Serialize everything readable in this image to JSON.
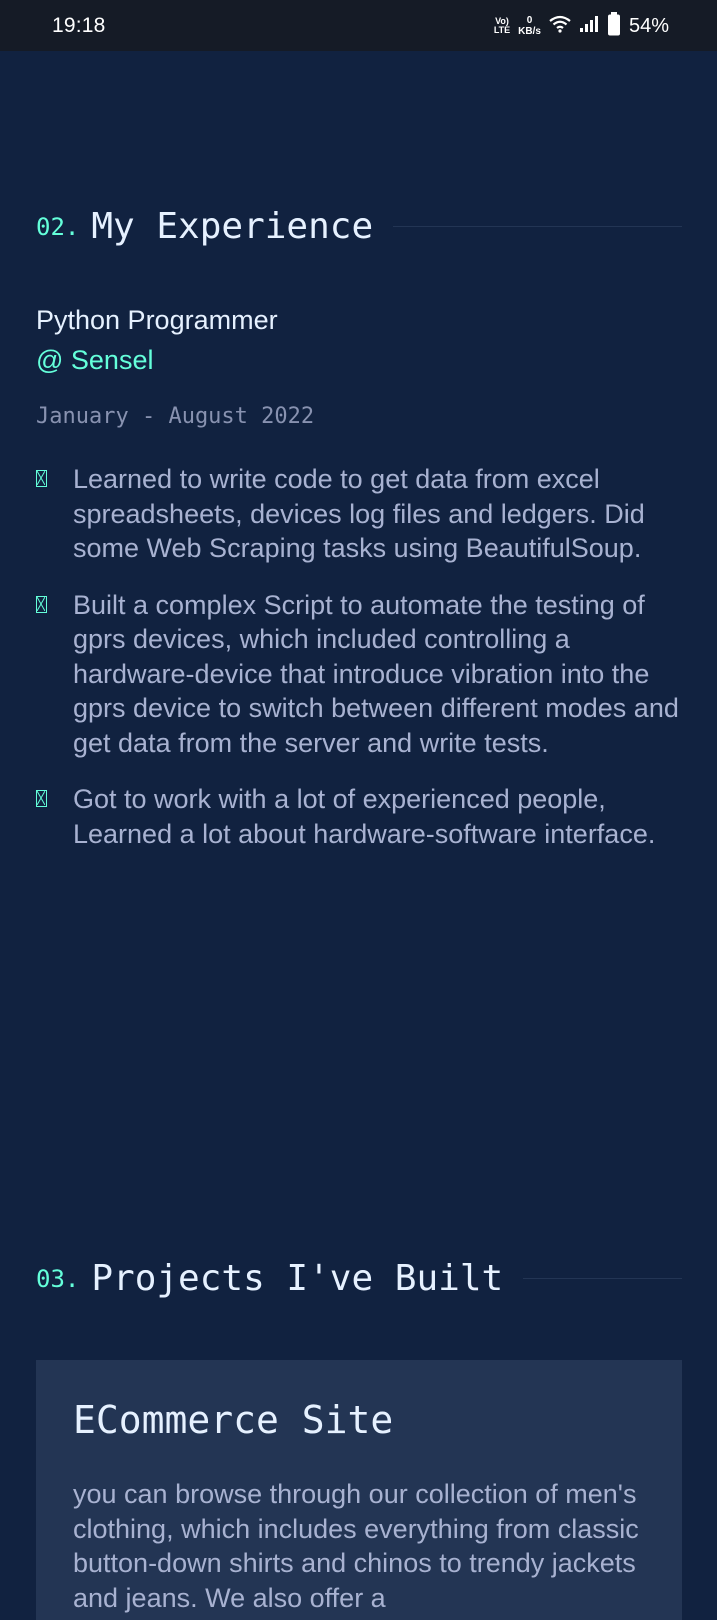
{
  "status_bar": {
    "time": "19:18",
    "volte_top": "Vo)",
    "volte_bottom": "LTE",
    "speed_value": "0",
    "speed_unit": "KB/s",
    "battery": "54%",
    "icons": [
      "wifi-icon",
      "signal-icon",
      "battery-icon"
    ]
  },
  "experience": {
    "number": "02.",
    "title": "My Experience",
    "job_title": "Python Programmer",
    "company": "@ Sensel",
    "dates": "January - August 2022",
    "bullets": [
      "Learned to write code to get data from excel spreadsheets, devices log files and ledgers. Did some Web Scraping tasks using BeautifulSoup.",
      "Built a complex Script to automate the testing of gprs devices, which included controlling a hardware-device that introduce vibration into the gprs device to switch between different modes and get data from the server and write tests.",
      "Got to work with a lot of experienced people, Learned a lot about hardware-software interface."
    ]
  },
  "projects": {
    "number": "03.",
    "title": "Projects I've Built",
    "items": [
      {
        "title": "ECommerce Site",
        "description": "you can browse through our collection of men's clothing, which includes everything from classic button-down shirts and chinos to trendy jackets and jeans. We also offer a"
      }
    ]
  },
  "colors": {
    "background": "#112240",
    "accent": "#64ffda",
    "heading": "#e6f1ff",
    "body_text": "#a8b2d1",
    "muted": "#8892b0",
    "card": "#233554",
    "status_bar": "#151b26"
  }
}
